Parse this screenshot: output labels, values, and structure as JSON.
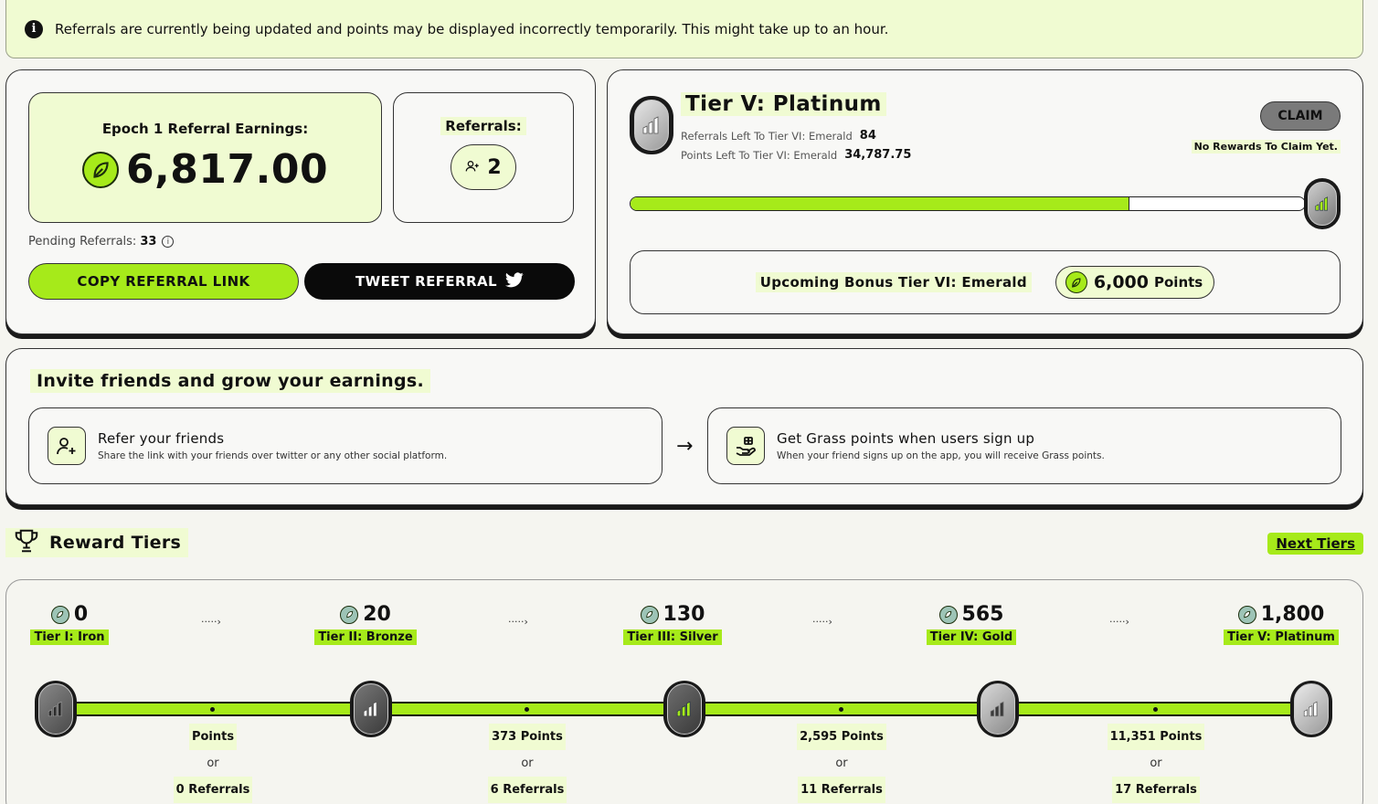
{
  "banner": {
    "icon": "info-icon",
    "message": "Referrals are currently being updated and points may be displayed incorrectly temporarily. This might take up to an hour."
  },
  "earnings": {
    "label": "Epoch 1 Referral Earnings:",
    "value": "6,817.00",
    "icon": "grass-leaf-icon"
  },
  "referrals": {
    "label": "Referrals:",
    "count": "2",
    "icon": "users-plus-icon"
  },
  "pending": {
    "label": "Pending Referrals:",
    "value": "33"
  },
  "buttons": {
    "copy_label": "COPY REFERRAL LINK",
    "tweet_label": "TWEET REFERRAL"
  },
  "current_tier": {
    "title": "Tier V: Platinum",
    "referrals_left_label": "Referrals Left To Tier VI: Emerald",
    "referrals_left_value": "84",
    "points_left_label": "Points Left To Tier VI: Emerald",
    "points_left_value": "34,787.75",
    "claim_label": "CLAIM",
    "claim_note": "No Rewards To Claim Yet.",
    "progress": 0.74
  },
  "bonus": {
    "label": "Upcoming Bonus Tier VI: Emerald",
    "value": "6,000",
    "unit": "Points"
  },
  "invite": {
    "title": "Invite friends and grow your earnings.",
    "steps": [
      {
        "title": "Refer your friends",
        "desc": "Share the link with your friends over twitter or any other social platform.",
        "icon": "user-plus-icon"
      },
      {
        "title": "Get Grass points when users sign up",
        "desc": "When your friend signs up on the app, you will receive Grass points.",
        "icon": "hand-gift-icon"
      }
    ]
  },
  "reward_tiers": {
    "title": "Reward Tiers",
    "next_label": "Next Tiers",
    "tiers": [
      {
        "points": "0",
        "name": "Tier I: Iron"
      },
      {
        "points": "20",
        "name": "Tier II: Bronze"
      },
      {
        "points": "130",
        "name": "Tier III: Silver"
      },
      {
        "points": "565",
        "name": "Tier IV: Gold"
      },
      {
        "points": "1,800",
        "name": "Tier V: Platinum"
      }
    ],
    "requirements": [
      {
        "points": "Points",
        "or": "or",
        "referrals": "0 Referrals"
      },
      {
        "points": "373 Points",
        "or": "or",
        "referrals": "6 Referrals"
      },
      {
        "points": "2,595 Points",
        "or": "or",
        "referrals": "11 Referrals"
      },
      {
        "points": "11,351 Points",
        "or": "or",
        "referrals": "17 Referrals"
      }
    ],
    "arrow_glyph": "·····›"
  },
  "colors": {
    "accent": "#a6ea1a",
    "highlight": "#f0fbd2",
    "dark": "#0a0a0a"
  }
}
